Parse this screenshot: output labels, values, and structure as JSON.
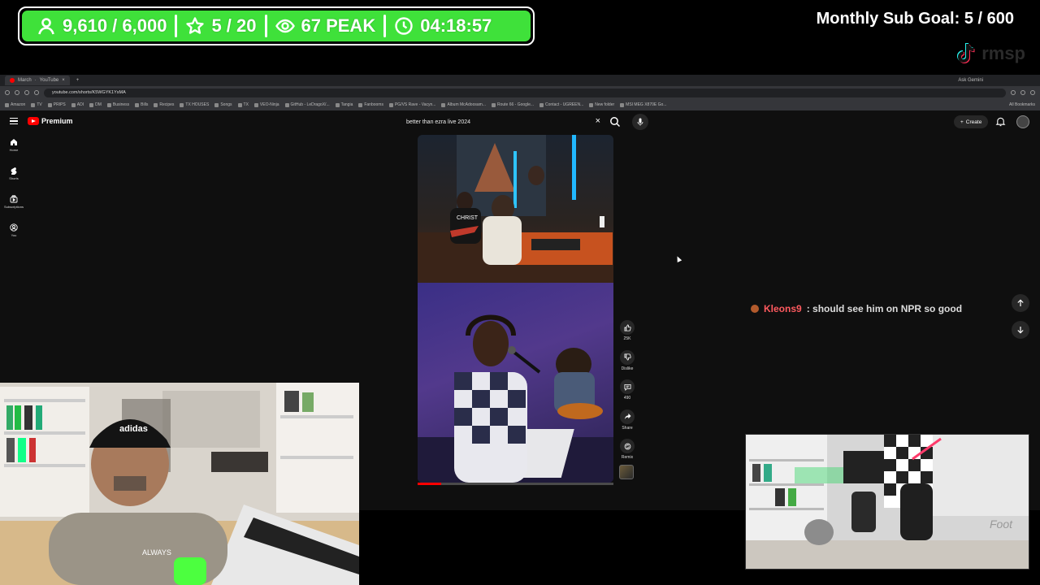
{
  "stream_overlay": {
    "followers": "9,610 / 6,000",
    "stars": "5 / 20",
    "viewers": "67 PEAK",
    "uptime": "04:18:57",
    "sub_goal": "Monthly Sub Goal:  5 / 600",
    "tiktok_name": "rmsp",
    "colors": {
      "stats_green": "#3fe13a"
    }
  },
  "browser": {
    "tabs": [
      {
        "label": "March"
      },
      {
        "label": "YouTube"
      }
    ],
    "gemini_label": "Ask Gemini",
    "url": "youtube.com/shorts/K5WGYK1YsMA",
    "bookmarks": [
      "Amazon",
      "TV",
      "PRIPS",
      "ADI",
      "DM",
      "Business",
      "Bills",
      "Recipes",
      "TX HOUSES",
      "Songs",
      "TX",
      "VEO-Ninja",
      "GitHub - LeDragoX/...",
      "Tangia",
      "Fanbooms",
      "PG/VS Rave - Vacyn...",
      "Album McAdoosam...",
      "Route 66 - Google...",
      "Contact - UGREEN...",
      "New folder",
      "MSI MEG X870E Go..."
    ],
    "all_bookmarks": "All Bookmarks"
  },
  "youtube": {
    "logo_text": "Premium",
    "search_query": "better than ezra live 2024",
    "create_label": "Create",
    "nav": [
      {
        "label": "Home",
        "icon": "home-icon"
      },
      {
        "label": "Shorts",
        "icon": "shorts-icon"
      },
      {
        "label": "Subscriptions",
        "icon": "subscriptions-icon"
      },
      {
        "label": "You",
        "icon": "you-icon"
      }
    ],
    "actions": {
      "like_count": "25K",
      "dislike_label": "Dislike",
      "comment_count": "490",
      "share_label": "Share",
      "remix_label": "Remix"
    },
    "progress": 0.12
  },
  "chat": {
    "username": "Kleons9",
    "message": ": should see him on NPR so good"
  },
  "overlay_texts": {
    "shirt_text": "CHRIST",
    "cap_text": "adidas",
    "tee_text": "ALWAYS",
    "wall_sign": "Foot"
  }
}
